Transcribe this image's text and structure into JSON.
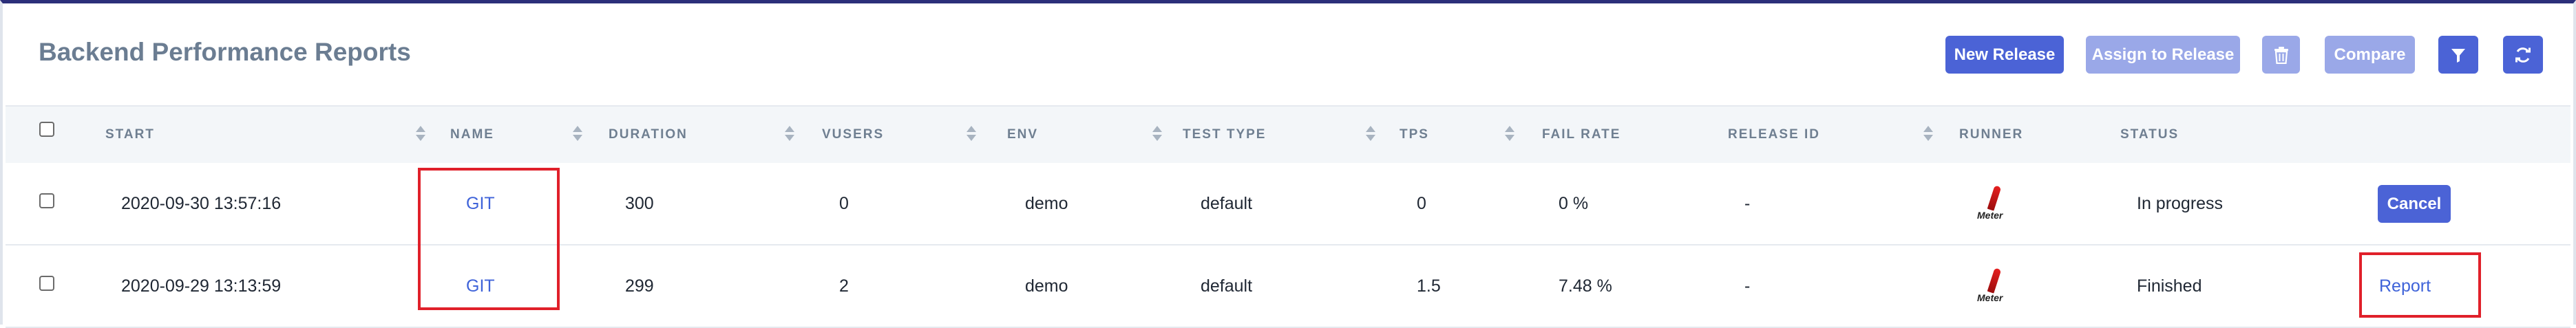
{
  "page": {
    "title": "Backend Performance Reports"
  },
  "toolbar": {
    "new_release": "New Release",
    "assign_to_release": "Assign to Release",
    "compare": "Compare"
  },
  "icons": {
    "delete": "trash-icon",
    "filter": "filter-icon",
    "refresh": "refresh-icon",
    "runner": "jmeter-logo"
  },
  "runner_logo_text": "Meter",
  "table": {
    "columns": {
      "start": "START",
      "name": "NAME",
      "duration": "DURATION",
      "vusers": "VUSERS",
      "env": "ENV",
      "test_type": "TEST TYPE",
      "tps": "TPS",
      "fail_rate": "FAIL RATE",
      "release_id": "RELEASE ID",
      "runner": "RUNNER",
      "status": "STATUS"
    },
    "rows": [
      {
        "start": "2020-09-30 13:57:16",
        "name": "GIT",
        "duration": "300",
        "vusers": "0",
        "env": "demo",
        "test_type": "default",
        "tps": "0",
        "fail_rate": "0 %",
        "release_id": "-",
        "status": "In progress",
        "action": "Cancel"
      },
      {
        "start": "2020-09-29 13:13:59",
        "name": "GIT",
        "duration": "299",
        "vusers": "2",
        "env": "demo",
        "test_type": "default",
        "tps": "1.5",
        "fail_rate": "7.48 %",
        "release_id": "-",
        "status": "Finished",
        "action": "Report"
      }
    ]
  },
  "colors": {
    "primary": "#4b63d6",
    "primary_disabled": "#9aa8e8",
    "link": "#3f63d9",
    "highlight": "#e0202a",
    "title": "#6b7d92"
  }
}
